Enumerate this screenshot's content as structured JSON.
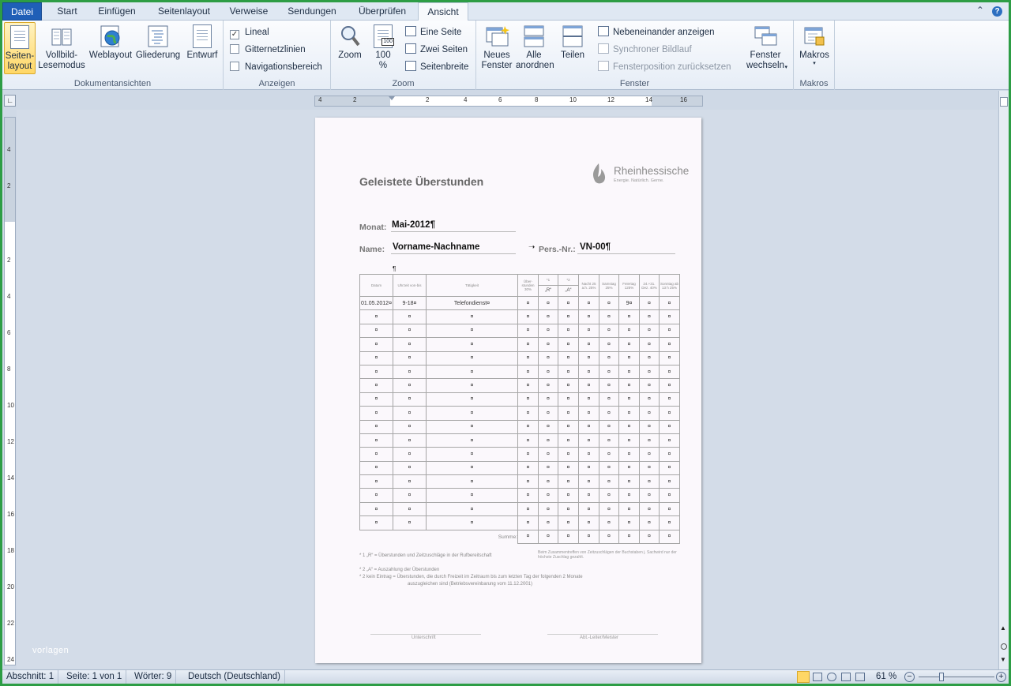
{
  "tabs": [
    "Datei",
    "Start",
    "Einfügen",
    "Seitenlayout",
    "Verweise",
    "Sendungen",
    "Überprüfen",
    "Ansicht"
  ],
  "ribbon": {
    "views": {
      "label": "Dokumentansichten",
      "page_layout": "Seiten-\nlayout",
      "fullscreen": "Vollbild-\nLesemodus",
      "web": "Weblayout",
      "outline": "Gliederung",
      "draft": "Entwurf"
    },
    "show": {
      "label": "Anzeigen",
      "ruler": "Lineal",
      "gridlines": "Gitternetzlinien",
      "navigation": "Navigationsbereich"
    },
    "zoom": {
      "label": "Zoom",
      "zoom": "Zoom",
      "hundred": "100\n%",
      "hundred_icon": "100",
      "one_page": "Eine Seite",
      "two_pages": "Zwei Seiten",
      "page_width": "Seitenbreite"
    },
    "window": {
      "label": "Fenster",
      "new_window": "Neues\nFenster",
      "arrange_all": "Alle\nanordnen",
      "split": "Teilen",
      "side_by_side": "Nebeneinander anzeigen",
      "sync_scroll": "Synchroner Bildlauf",
      "reset_position": "Fensterposition zurücksetzen",
      "switch": "Fenster\nwechseln"
    },
    "macros": {
      "label": "Makros",
      "macros": "Makros"
    }
  },
  "ruler": {
    "h_ticks": [
      "4",
      "2",
      "2",
      "4",
      "6",
      "8",
      "10",
      "12",
      "14",
      "16"
    ],
    "v_ticks": [
      "4",
      "2",
      "2",
      "4",
      "6",
      "8",
      "10",
      "12",
      "14",
      "16",
      "18",
      "20",
      "22",
      "24"
    ]
  },
  "doc": {
    "title": "Geleistete Überstunden",
    "logo_name": "Rheinhessische",
    "logo_tagline": "Energie. Natürlich. Gerne.",
    "month_label": "Monat:",
    "month_value": "Mai-2012¶",
    "name_label": "Name:",
    "name_value": "Vorname-Nachname",
    "persnr_label": "Pers.-Nr.:",
    "persnr_value": "VN-00¶",
    "pilcrow": "¶",
    "headers": [
      "Datum",
      "Uhrzeit von-bis",
      "Tätigkeit",
      "Über-stunden 30%",
      "*1",
      "*2",
      "Nacht 25 a.h. 25%",
      "Samstag 25%",
      "Feiertag 125%",
      "24.+31. Dez. 40%",
      "Sonntag ab 13 h 25%"
    ],
    "sub_r": "„R“",
    "sub_a": "„A“",
    "first_row": {
      "date": "01.05.2012¤",
      "time": "9-18¤",
      "activity": "Telefondienst¤",
      "holiday": "9¤"
    },
    "cell": "¤",
    "sum_label": "Summe:",
    "note_right": "Beim Zusammentreffen von Zeitzuschlägen der Buchstaben j. Sachwird nur der höchste Zuschlag gezahlt.",
    "foot1": "* 1   „R“ = Überstunden und Zeitzuschläge in der Rufbereitschaft",
    "foot2": "* 2   „A“ = Auszahlung der Überstunden",
    "foot3": "* 2   kein Eintrag = Überstunden, die durch Freizeit im Zeitraum bis zum letzten Tag der folgenden 2 Monate",
    "foot4": "auszugleichen sind  (Betriebsvereinbarung vom 11.12.2001)",
    "sign1": "Unterschrift",
    "sign2": "Abt.-Leiter/Meister"
  },
  "watermark": "vorlagen",
  "status": {
    "section": "Abschnitt: 1",
    "page": "Seite: 1 von 1",
    "words": "Wörter: 9",
    "language": "Deutsch (Deutschland)",
    "zoom": "61 %",
    "zoom_fraction": 0.61
  },
  "colors": {
    "accent": "#1f5fb7",
    "frame": "#2d9d45",
    "selected": "#ffd766"
  }
}
